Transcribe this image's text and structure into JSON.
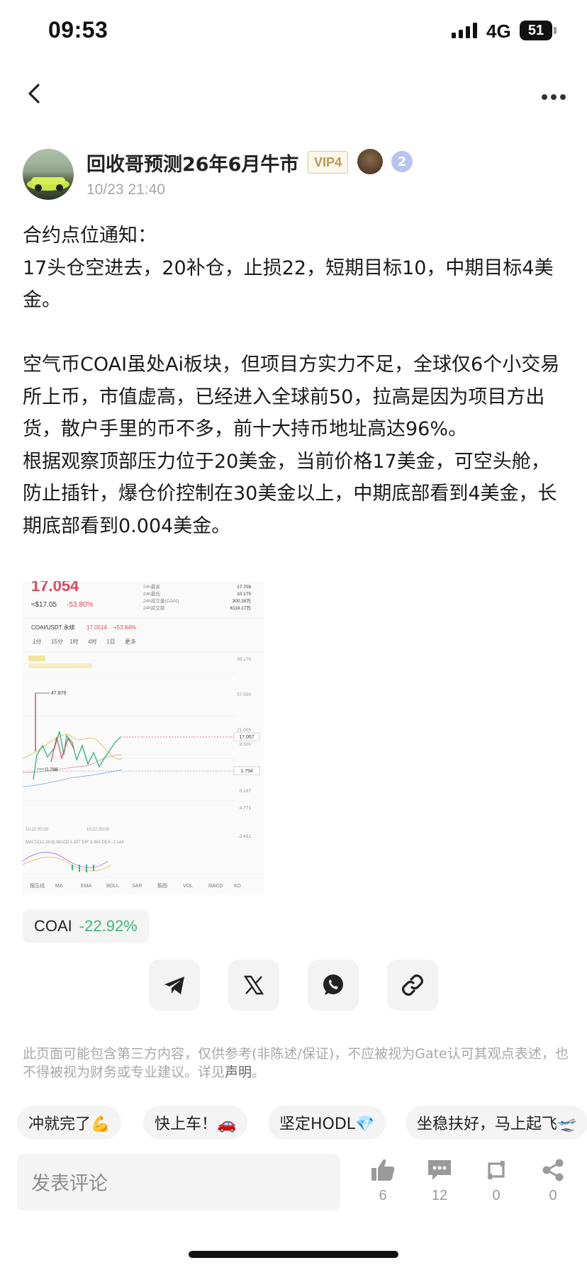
{
  "status_bar": {
    "time": "09:53",
    "network": "4G",
    "battery": "51"
  },
  "post": {
    "author": "回收哥预测26年6月牛市",
    "vip": "VIP4",
    "level_badge": "2",
    "time": "10/23 21:40",
    "paragraphs": [
      "合约点位通知：",
      "17头仓空进去，20补仓，止损22，短期目标10，中期目标4美金。",
      "",
      "空气币COAI虽处Ai板块，但项目方实力不足，全球仅6个小交易所上币，市值虚高，已经进入全球前50，拉高是因为项目方出货，散户手里的币不多，前十大持币地址高达96%。",
      "根据观察顶部压力位于20美金，当前价格17美金，可空头舱，防止插针，爆仓价控制在30美金以上，中期底部看到4美金，长期底部看到0.004美金。"
    ]
  },
  "chart_image": {
    "price": "17.054",
    "sub_price": "≈$17.05",
    "sub_change": "-53.80%",
    "pair": "COAI/USDT 永续",
    "pair_price": "17.0514",
    "pair_change": "+53.84%",
    "stats": [
      {
        "label": "24h最高",
        "value": "17.708"
      },
      {
        "label": "24h最低",
        "value": "10.175"
      },
      {
        "label": "24h成交量(COAI)",
        "value": "300.28万"
      },
      {
        "label": "24h成交额",
        "value": "6119.17万"
      }
    ],
    "timeframes": [
      "1分",
      "15分",
      "1时",
      "4时",
      "1日",
      "更多"
    ],
    "high_label": "47.879",
    "low_label": "0.798",
    "current_tag": "17.057",
    "low_tag": "1.754",
    "axis_labels": [
      "38.175",
      "57.550",
      "21.005",
      "9.300",
      "0.187",
      "4.771",
      "-3.481"
    ],
    "date_labels": [
      "10-10 00:00",
      "10-22 00:00"
    ],
    "indicator_line": "MACD(12,26,9)  MACD:1.207  DIF:3.083  DEA:-3.144",
    "indicator_tabs": [
      "摆压线",
      "MA",
      "EMA",
      "BOLL",
      "SAR",
      "筋图",
      "VOL",
      "MACD",
      "KD"
    ]
  },
  "coin_tag": {
    "name": "COAI",
    "change": "-22.92%"
  },
  "share_icons": [
    "telegram-icon",
    "x-icon",
    "whatsapp-icon",
    "link-icon"
  ],
  "disclaimer": {
    "text": "此页面可能包含第三方内容，仅供参考(非陈述/保证)，不应被视为Gate认可其观点表述，也不得被视为财务或专业建议。详见",
    "link": "声明",
    "end": "。"
  },
  "quick_replies": [
    "冲就完了💪",
    "快上车！🚗",
    "坚定HODL💎",
    "坐稳扶好，马上起飞🛫"
  ],
  "comment": {
    "placeholder": "发表评论"
  },
  "actions": [
    {
      "icon": "thumbs-up-icon",
      "count": "6"
    },
    {
      "icon": "comment-icon",
      "count": "12"
    },
    {
      "icon": "repost-icon",
      "count": "0"
    },
    {
      "icon": "share-icon",
      "count": "0"
    }
  ],
  "colors": {
    "up_green": "#3cb680",
    "down_red": "#e0475b",
    "vip_gold": "#b79a52",
    "muted": "#a6a6a6"
  }
}
